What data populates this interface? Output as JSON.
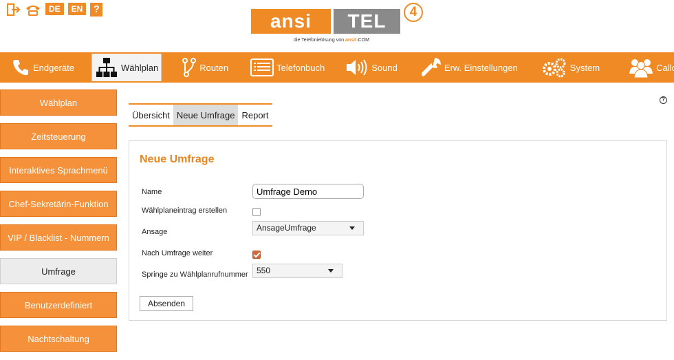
{
  "top_icons": {
    "logout_icon": "exit-icon",
    "phone_icon": "phone-icon",
    "lang_de": "DE",
    "lang_en": "EN",
    "help": "?"
  },
  "logo": {
    "part1": "ansi",
    "part2": "TEL",
    "version": "4",
    "tagline_prefix": "die Telefonielösung von",
    "tagline_brand": "ansit",
    "tagline_suffix": "·COM"
  },
  "nav": {
    "items": [
      {
        "label": "Endgeräte",
        "icon": "phone-icon"
      },
      {
        "label": "Wählplan",
        "icon": "hierarchy-icon"
      },
      {
        "label": "Routen",
        "icon": "route-icon"
      },
      {
        "label": "Telefonbuch",
        "icon": "phonebook-icon"
      },
      {
        "label": "Sound",
        "icon": "speaker-icon"
      },
      {
        "label": "Erw. Einstellungen",
        "icon": "wrench-icon"
      },
      {
        "label": "System",
        "icon": "gears-icon"
      },
      {
        "label": "Callcenter",
        "icon": "users-icon"
      }
    ],
    "active": "Wählplan"
  },
  "sidebar": {
    "items": [
      {
        "label": "Wählplan"
      },
      {
        "label": "Zeitsteuerung"
      },
      {
        "label": "Interaktives Sprachmenü"
      },
      {
        "label": "Chef-Sekretärin-Funktion"
      },
      {
        "label": "VIP / Blacklist - Nummern"
      },
      {
        "label": "Umfrage"
      },
      {
        "label": "Benutzerdefiniert"
      },
      {
        "label": "Nachtschaltung"
      }
    ],
    "active": "Umfrage"
  },
  "subtabs": {
    "items": [
      {
        "label": "Übersicht"
      },
      {
        "label": "Neue Umfrage"
      },
      {
        "label": "Report"
      }
    ],
    "active": "Neue Umfrage"
  },
  "form": {
    "title": "Neue Umfrage",
    "name_label": "Name",
    "name_value": "Umfrage Demo",
    "create_entry_label": "Wählplaneintrag erstellen",
    "create_entry_checked": false,
    "announcement_label": "Ansage",
    "announcement_value": "AnsageUmfrage",
    "continue_label": "Nach Umfrage weiter",
    "continue_checked": true,
    "jump_label": "Springe zu Wählplanrufnummer",
    "jump_value": "550",
    "submit_label": "Absenden"
  },
  "colors": {
    "accent": "#f08a24",
    "logo_gray": "#8a8a8a",
    "title": "#e8861f"
  }
}
